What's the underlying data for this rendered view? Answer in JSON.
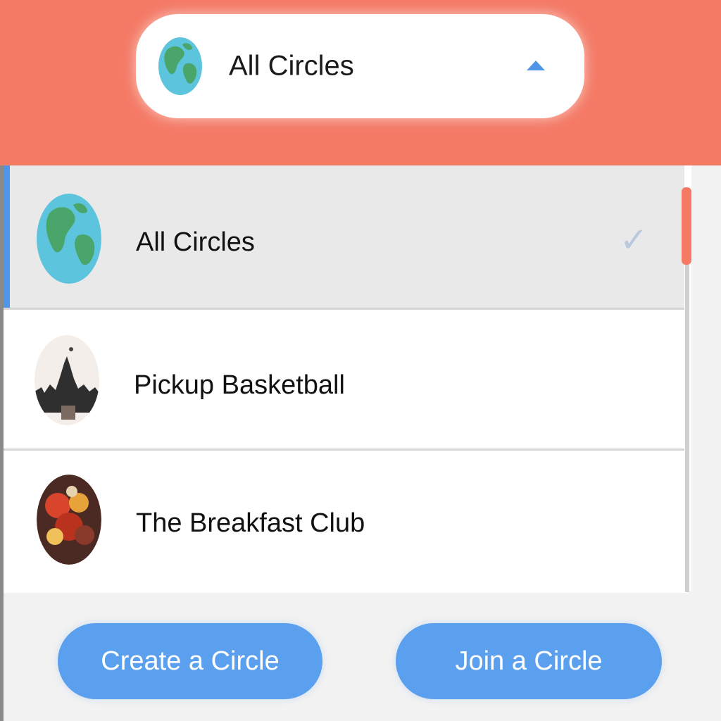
{
  "selector": {
    "label": "All Circles",
    "icon": "globe-icon",
    "caret_icon": "chevron-up-icon"
  },
  "circles": [
    {
      "name": "All Circles",
      "icon": "globe-icon",
      "selected": true
    },
    {
      "name": "Pickup Basketball",
      "icon": "basketball-avatar",
      "selected": false
    },
    {
      "name": "The Breakfast Club",
      "icon": "breakfast-avatar",
      "selected": false
    }
  ],
  "actions": {
    "create_label": "Create a Circle",
    "join_label": "Join a Circle"
  },
  "colors": {
    "header": "#f47a66",
    "accent": "#4f95e8",
    "button": "#5aa0ee"
  }
}
